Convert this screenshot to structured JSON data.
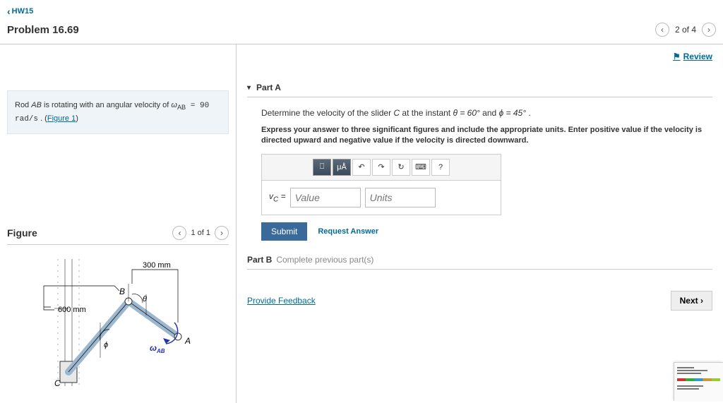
{
  "header": {
    "back_label": "HW15",
    "title": "Problem 16.69",
    "pager_text": "2 of 4"
  },
  "review_label": "Review",
  "intro": {
    "text_before": "Rod ",
    "rod": "AB",
    "text_mid": " is rotating with an angular velocity of ",
    "omega": "ω",
    "sub": "AB",
    "eq": " = 90 rad/s",
    "text_after": " . (",
    "link": "Figure 1",
    "close": ")"
  },
  "figure": {
    "title": "Figure",
    "pager_text": "1 of 1",
    "dim_ab": "300 mm",
    "dim_bc": "600 mm",
    "label_B": "B",
    "label_A": "A",
    "label_C": "C",
    "label_theta": "θ",
    "label_phi": "ϕ",
    "label_omega": "ω",
    "label_omega_sub": "AB"
  },
  "partA": {
    "title": "Part A",
    "prompt_before": "Determine the velocity of the slider ",
    "slider": "C",
    "prompt_mid": " at the instant ",
    "theta": "θ = 60°",
    "and": " and ",
    "phi": "ϕ = 45°",
    "end": " .",
    "instructions": "Express your answer to three significant figures and include the appropriate units. Enter positive value if the velocity is directed upward and negative value if the velocity is directed downward.",
    "toolbar": {
      "templates": "⎕",
      "units": "μÅ",
      "undo": "↶",
      "redo": "↷",
      "reset": "↻",
      "keyboard": "⌨",
      "help": "?"
    },
    "eq_label": "v",
    "eq_sub": "C",
    "eq_after": " = ",
    "value_placeholder": "Value",
    "units_placeholder": "Units",
    "submit": "Submit",
    "request": "Request Answer"
  },
  "partB": {
    "title": "Part B",
    "status": "Complete previous part(s)"
  },
  "feedback_label": "Provide Feedback",
  "next_label": "Next"
}
